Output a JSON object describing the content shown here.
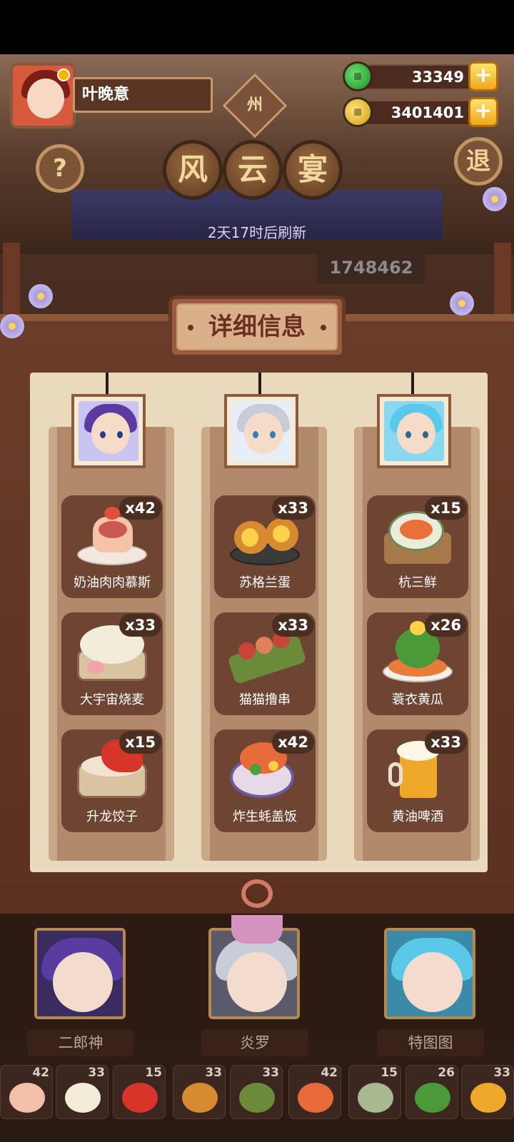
{
  "player": {
    "name": "叶晚意"
  },
  "region": {
    "label": "州"
  },
  "currency": {
    "jade": {
      "amount": "33349",
      "plus": "+"
    },
    "gold": {
      "amount": "3401401",
      "plus": "+"
    }
  },
  "buttons": {
    "help": "?",
    "exit": "退"
  },
  "event_title": [
    "风",
    "云",
    "宴"
  ],
  "refresh_text": "2天17时后刷新",
  "score": "1748462",
  "panel": {
    "header": "详细信息",
    "columns": [
      {
        "character": "二郎神",
        "dishes": [
          {
            "name": "奶油肉肉慕斯",
            "count": "x42"
          },
          {
            "name": "大宇宙烧麦",
            "count": "x33"
          },
          {
            "name": "升龙饺子",
            "count": "x15"
          }
        ]
      },
      {
        "character": "炎罗",
        "dishes": [
          {
            "name": "苏格兰蛋",
            "count": "x33"
          },
          {
            "name": "猫猫撸串",
            "count": "x33"
          },
          {
            "name": "炸生蚝盖饭",
            "count": "x42"
          }
        ]
      },
      {
        "character": "特图图",
        "dishes": [
          {
            "name": "杭三鲜",
            "count": "x15"
          },
          {
            "name": "蓑衣黄瓜",
            "count": "x26"
          },
          {
            "name": "黄油啤酒",
            "count": "x33"
          }
        ]
      }
    ]
  },
  "heroes": [
    "二郎神",
    "炎罗",
    "特图图"
  ],
  "strip_counts": [
    "42",
    "33",
    "15",
    "33",
    "33",
    "42",
    "15",
    "26",
    "33"
  ],
  "colors": {
    "accent_gold": "#f0a81a",
    "jade": "#1b8e2a",
    "panel": "#e9d9bd"
  }
}
